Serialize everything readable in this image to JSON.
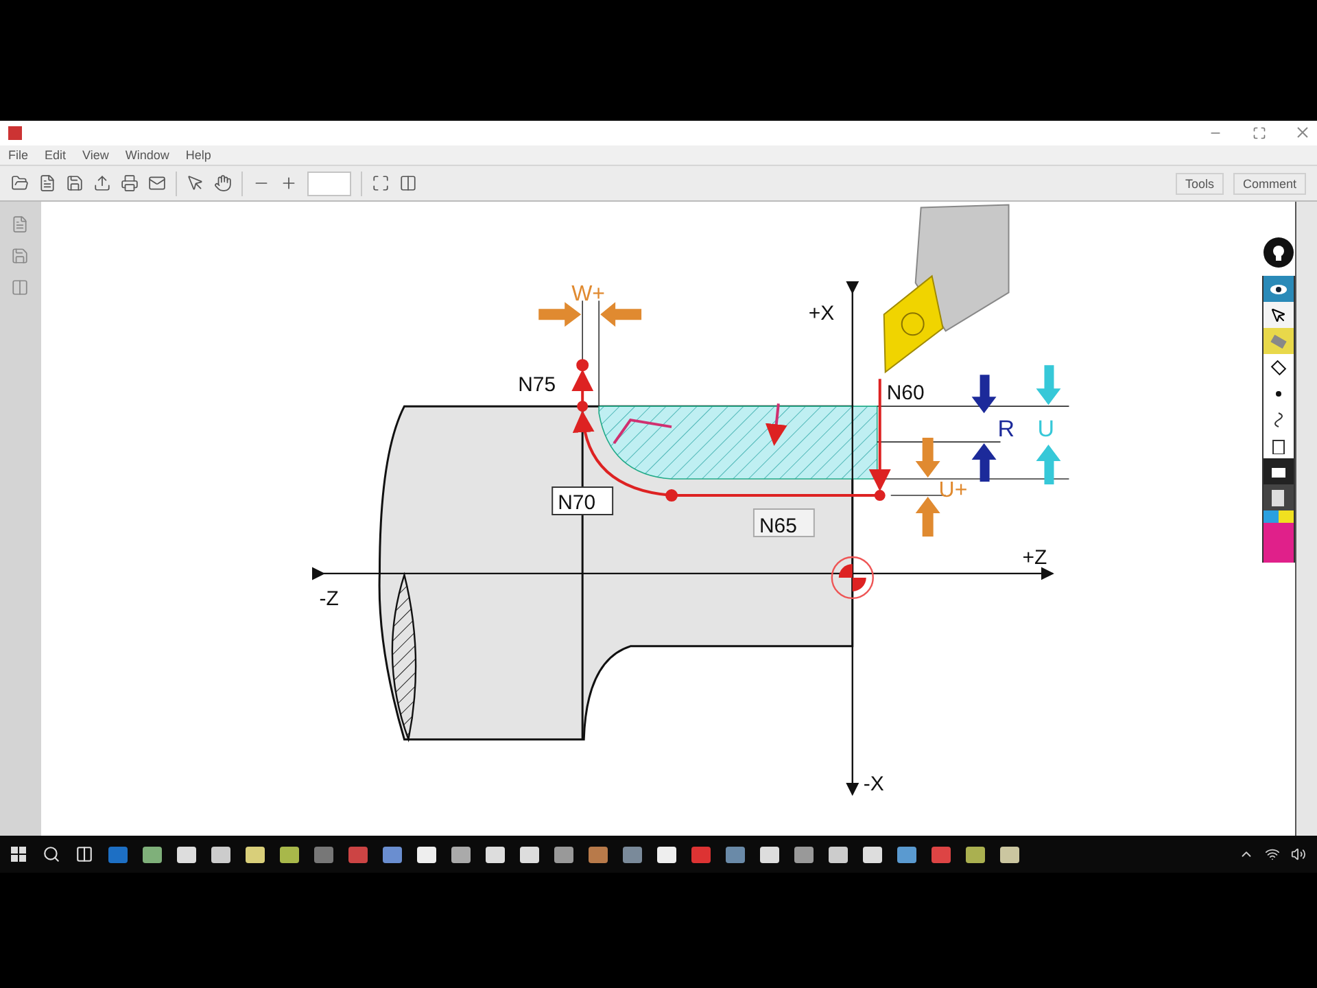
{
  "menu": [
    "File",
    "Edit",
    "View",
    "Window",
    "Help"
  ],
  "toolbar": {
    "tools_button": "Tools",
    "comment_button": "Comment"
  },
  "diagram": {
    "axis_labels": {
      "plus_x": "+X",
      "minus_x": "-X",
      "plus_z": "+Z",
      "minus_z": "-Z"
    },
    "blocks": {
      "n60": "N60",
      "n65": "N65",
      "n70": "N70",
      "n75": "N75"
    },
    "allowances": {
      "w_plus": "W+",
      "u_plus": "U+",
      "r": "R",
      "u": "U"
    }
  }
}
